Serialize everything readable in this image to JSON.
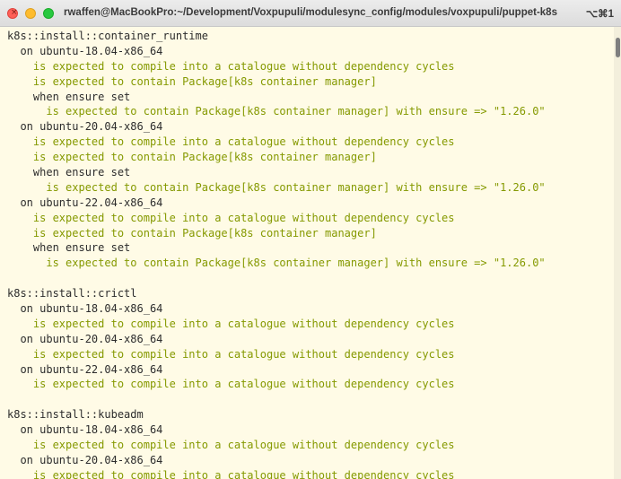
{
  "window": {
    "title": "rwaffen@MacBookPro:~/Development/Voxpupuli/modulesync_config/modules/voxpupuli/puppet-k8s",
    "shortcut": "⌥⌘1"
  },
  "terminal": {
    "colors": {
      "background": "#fffbe6",
      "pass": "#859900",
      "text": "#2c2c2c"
    },
    "lines": [
      {
        "text": "k8s::install::container_runtime",
        "kind": "group"
      },
      {
        "text": "  on ubuntu-18.04-x86_64",
        "kind": "context"
      },
      {
        "text": "    is expected to compile into a catalogue without dependency cycles",
        "kind": "pass"
      },
      {
        "text": "    is expected to contain Package[k8s container manager]",
        "kind": "pass"
      },
      {
        "text": "    when ensure set",
        "kind": "context"
      },
      {
        "text": "      is expected to contain Package[k8s container manager] with ensure => \"1.26.0\"",
        "kind": "pass"
      },
      {
        "text": "  on ubuntu-20.04-x86_64",
        "kind": "context"
      },
      {
        "text": "    is expected to compile into a catalogue without dependency cycles",
        "kind": "pass"
      },
      {
        "text": "    is expected to contain Package[k8s container manager]",
        "kind": "pass"
      },
      {
        "text": "    when ensure set",
        "kind": "context"
      },
      {
        "text": "      is expected to contain Package[k8s container manager] with ensure => \"1.26.0\"",
        "kind": "pass"
      },
      {
        "text": "  on ubuntu-22.04-x86_64",
        "kind": "context"
      },
      {
        "text": "    is expected to compile into a catalogue without dependency cycles",
        "kind": "pass"
      },
      {
        "text": "    is expected to contain Package[k8s container manager]",
        "kind": "pass"
      },
      {
        "text": "    when ensure set",
        "kind": "context"
      },
      {
        "text": "      is expected to contain Package[k8s container manager] with ensure => \"1.26.0\"",
        "kind": "pass"
      },
      {
        "text": "",
        "kind": "blank"
      },
      {
        "text": "k8s::install::crictl",
        "kind": "group"
      },
      {
        "text": "  on ubuntu-18.04-x86_64",
        "kind": "context"
      },
      {
        "text": "    is expected to compile into a catalogue without dependency cycles",
        "kind": "pass"
      },
      {
        "text": "  on ubuntu-20.04-x86_64",
        "kind": "context"
      },
      {
        "text": "    is expected to compile into a catalogue without dependency cycles",
        "kind": "pass"
      },
      {
        "text": "  on ubuntu-22.04-x86_64",
        "kind": "context"
      },
      {
        "text": "    is expected to compile into a catalogue without dependency cycles",
        "kind": "pass"
      },
      {
        "text": "",
        "kind": "blank"
      },
      {
        "text": "k8s::install::kubeadm",
        "kind": "group"
      },
      {
        "text": "  on ubuntu-18.04-x86_64",
        "kind": "context"
      },
      {
        "text": "    is expected to compile into a catalogue without dependency cycles",
        "kind": "pass"
      },
      {
        "text": "  on ubuntu-20.04-x86_64",
        "kind": "context"
      },
      {
        "text": "    is expected to compile into a catalogue without dependency cycles",
        "kind": "pass"
      }
    ]
  }
}
